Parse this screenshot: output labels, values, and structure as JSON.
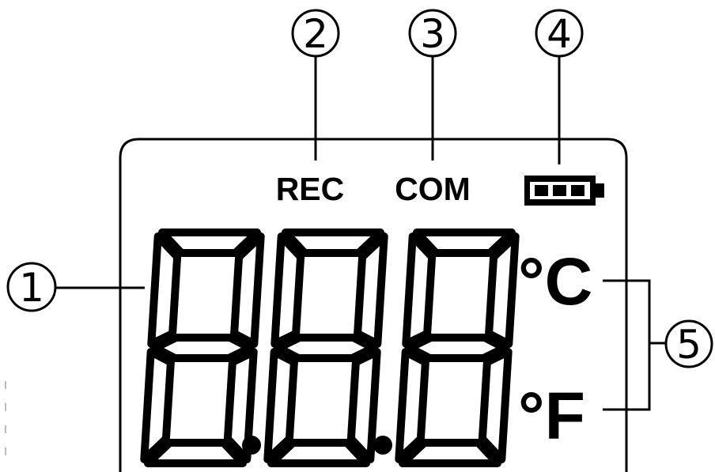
{
  "callouts": [
    {
      "number": "1"
    },
    {
      "number": "2"
    },
    {
      "number": "3"
    },
    {
      "number": "4"
    },
    {
      "number": "5"
    }
  ],
  "indicators": {
    "rec": "REC",
    "com": "COM",
    "battery_icon": "battery-full-icon"
  },
  "display": {
    "digits": 3,
    "decimal_points": 2
  },
  "units": {
    "celsius": "°C",
    "fahrenheit": "°F"
  }
}
